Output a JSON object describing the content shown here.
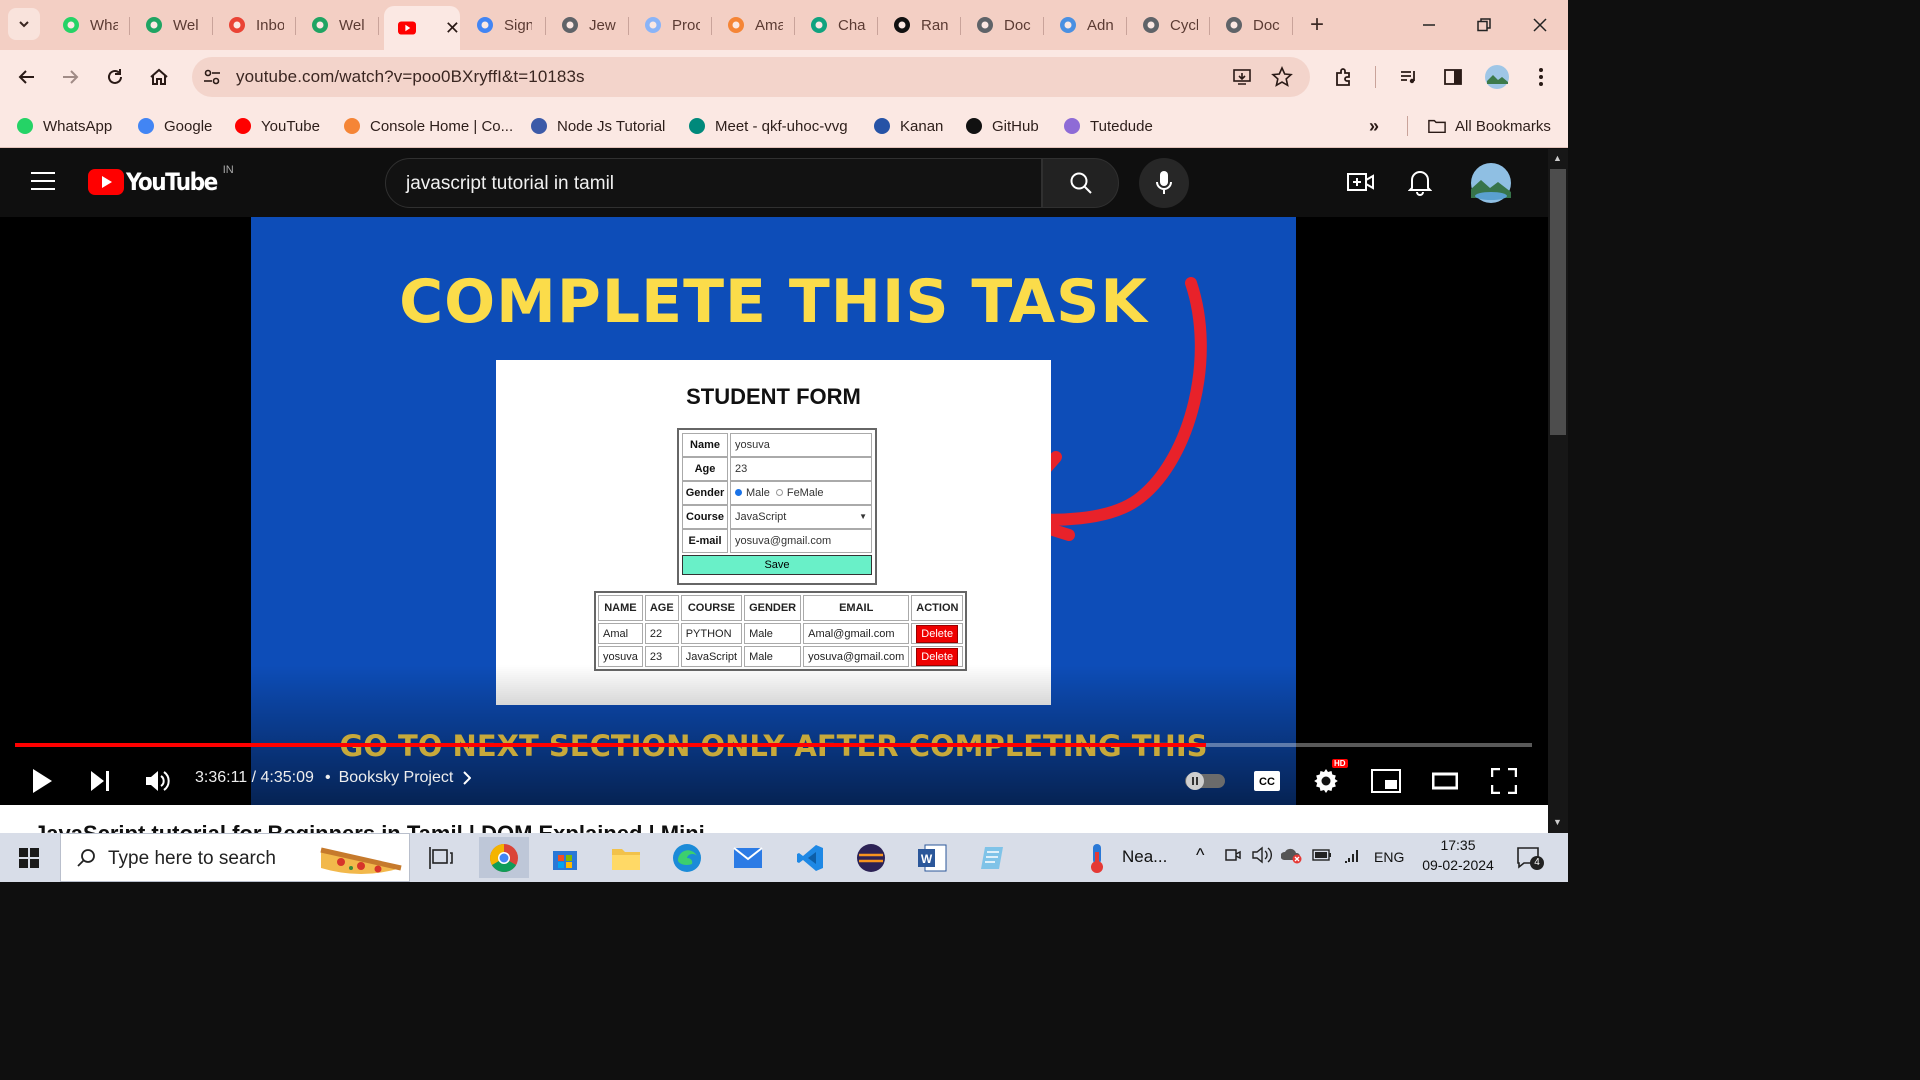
{
  "browser": {
    "tabs": [
      {
        "label": "Wha",
        "icon": "whatsapp-icon",
        "color": "#25d366"
      },
      {
        "label": "Wel",
        "icon": "google-drive-icon",
        "color": "#1fa463"
      },
      {
        "label": "Inbo",
        "icon": "gmail-icon",
        "color": "#ea4335"
      },
      {
        "label": "Wel",
        "icon": "google-drive-icon",
        "color": "#1fa463"
      },
      {
        "label": "",
        "icon": "youtube-icon",
        "color": "#ff0000",
        "active": true
      },
      {
        "label": "Sign",
        "icon": "google-icon",
        "color": "#4285f4"
      },
      {
        "label": "Jew",
        "icon": "globe-icon",
        "color": "#5f6368"
      },
      {
        "label": "Proc",
        "icon": "globe-icon",
        "color": "#8ab4f8"
      },
      {
        "label": "Ama",
        "icon": "aws-icon",
        "color": "#f58536"
      },
      {
        "label": "Cha",
        "icon": "chatgpt-icon",
        "color": "#10a37f"
      },
      {
        "label": "Ran",
        "icon": "github-icon",
        "color": "#111"
      },
      {
        "label": "Doc",
        "icon": "globe-icon",
        "color": "#5f6368"
      },
      {
        "label": "Adn",
        "icon": "cloud-icon",
        "color": "#4a90e2"
      },
      {
        "label": "Cycl",
        "icon": "globe-icon",
        "color": "#5f6368"
      },
      {
        "label": "Doc",
        "icon": "globe-icon",
        "color": "#5f6368"
      }
    ],
    "url": "youtube.com/watch?v=poo0BXryffI&t=10183s",
    "bookmarks": [
      {
        "label": "WhatsApp",
        "icon": "whatsapp-icon"
      },
      {
        "label": "Google",
        "icon": "google-icon"
      },
      {
        "label": "YouTube",
        "icon": "youtube-icon"
      },
      {
        "label": "Console Home | Co...",
        "icon": "aws-icon"
      },
      {
        "label": "Node Js Tutorial",
        "icon": "nodejs-icon"
      },
      {
        "label": "Meet - qkf-uhoc-vvg",
        "icon": "meet-icon"
      },
      {
        "label": "Kanan",
        "icon": "kanan-icon"
      },
      {
        "label": "GitHub",
        "icon": "github-icon"
      },
      {
        "label": "Tutedude",
        "icon": "book-icon"
      }
    ],
    "all_bookmarks": "All Bookmarks"
  },
  "youtube": {
    "country": "IN",
    "search_query": "javascript tutorial in tamil",
    "video": {
      "headline": "COMPLETE THIS TASK",
      "footer_text": "GO TO NEXT SECTION ONLY AFTER COMPLETING THIS",
      "form_title": "STUDENT FORM",
      "form": {
        "name_label": "Name",
        "name_value": "yosuva",
        "age_label": "Age",
        "age_value": "23",
        "gender_label": "Gender",
        "gender_male": "Male",
        "gender_female": "FeMale",
        "course_label": "Course",
        "course_value": "JavaScript",
        "email_label": "E-mail",
        "email_value": "yosuva@gmail.com",
        "save_label": "Save"
      },
      "table": {
        "headers": [
          "NAME",
          "AGE",
          "COURSE",
          "GENDER",
          "EMAIL",
          "ACTION"
        ],
        "rows": [
          [
            "Amal",
            "22",
            "PYTHON",
            "Male",
            "Amal@gmail.com",
            "Delete"
          ],
          [
            "yosuva",
            "23",
            "JavaScript",
            "Male",
            "yosuva@gmail.com",
            "Delete"
          ]
        ]
      }
    },
    "player": {
      "current_time": "3:36:11",
      "duration": "4:35:09",
      "time_display": "3:36:11 / 4:35:09",
      "chapter": "Booksky Project",
      "progress_fraction": 0.785,
      "hd_badge": "HD",
      "cc_label": "CC"
    },
    "below_title": "JavaScript tutorial for Beginners in Tamil | DOM Explained | Mini"
  },
  "taskbar": {
    "search_placeholder": "Type here to search",
    "weather": "Nea...",
    "language": "ENG",
    "time": "17:35",
    "date": "09-02-2024",
    "notifications": "4"
  }
}
